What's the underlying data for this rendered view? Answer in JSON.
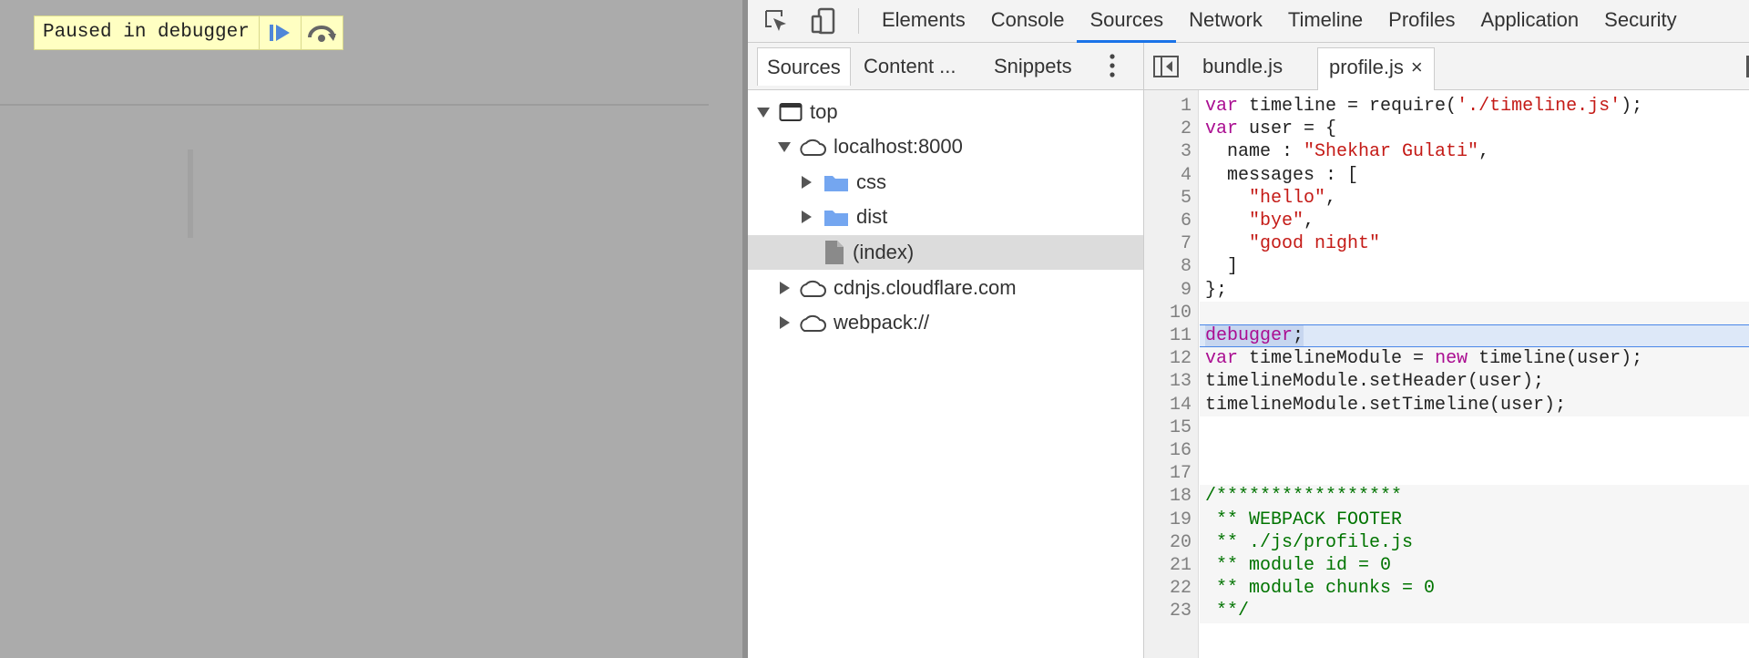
{
  "page": {
    "paused_label": "Paused in debugger"
  },
  "toolbar": {
    "tabs": [
      "Elements",
      "Console",
      "Sources",
      "Network",
      "Timeline",
      "Profiles",
      "Application",
      "Security"
    ],
    "active_tab": "Sources"
  },
  "navigator": {
    "tabs": [
      "Sources",
      "Content ...",
      "Snippets"
    ],
    "active_tab": "Sources",
    "tree": [
      {
        "label": "top",
        "icon": "frame-icon",
        "expanded": true
      },
      {
        "label": "localhost:8000",
        "icon": "cloud-icon",
        "expanded": true
      },
      {
        "label": "css",
        "icon": "folder-icon",
        "expanded": false
      },
      {
        "label": "dist",
        "icon": "folder-icon",
        "expanded": false
      },
      {
        "label": "(index)",
        "icon": "file-icon",
        "selected": true
      },
      {
        "label": "cdnjs.cloudflare.com",
        "icon": "cloud-icon",
        "expanded": false
      },
      {
        "label": "webpack://",
        "icon": "cloud-icon",
        "expanded": false
      }
    ]
  },
  "editor": {
    "tabs": [
      {
        "label": "bundle.js"
      },
      {
        "label": "profile.js",
        "close": "×"
      }
    ],
    "active_tab": "profile.js",
    "paused_line": 11,
    "lines": [
      "var timeline = require('./timeline.js');",
      "var user = {",
      "  name : \"Shekhar Gulati\",",
      "  messages : [",
      "    \"hello\",",
      "    \"bye\",",
      "    \"good night\"",
      "  ]",
      "};",
      "",
      "debugger;",
      "var timelineModule = new timeline(user);",
      "timelineModule.setHeader(user);",
      "timelineModule.setTimeline(user);",
      "",
      "",
      "",
      "/*****************",
      " ** WEBPACK FOOTER",
      " ** ./js/profile.js",
      " ** module id = 0",
      " ** module chunks = 0",
      " **/"
    ]
  },
  "colors": {
    "accent": "#1a73e8",
    "paused_bg": "#ffffc2",
    "keyword": "#aa0d91",
    "string": "#c41a16",
    "comment": "#007400",
    "folder": "#74a6f0"
  }
}
